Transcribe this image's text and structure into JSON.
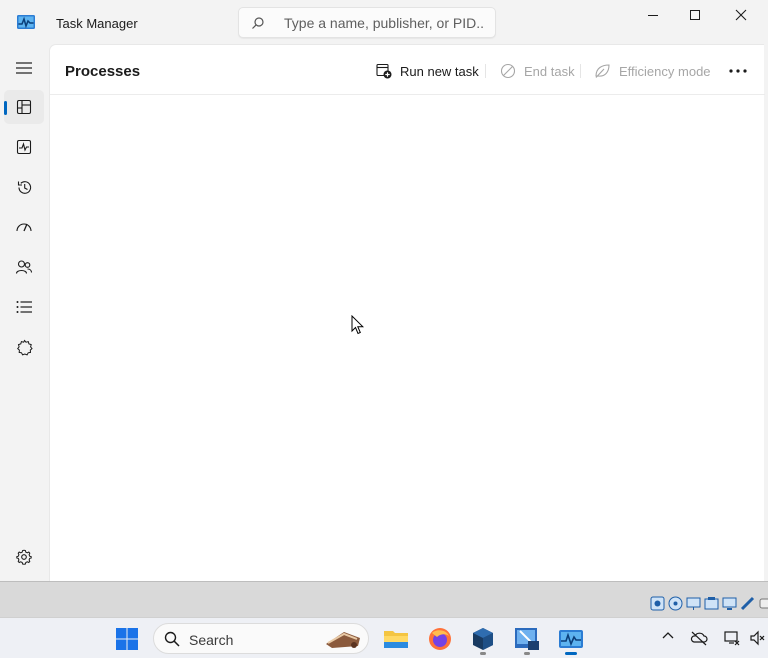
{
  "window": {
    "title": "Task Manager",
    "search_placeholder": "Type a name, publisher, or PID..."
  },
  "nav": {
    "items": [
      {
        "icon": "processes-icon",
        "selected": true
      },
      {
        "icon": "performance-icon"
      },
      {
        "icon": "app-history-icon"
      },
      {
        "icon": "startup-apps-icon"
      },
      {
        "icon": "users-icon"
      },
      {
        "icon": "details-icon"
      },
      {
        "icon": "services-icon"
      }
    ],
    "settings_icon": "gear-icon"
  },
  "page": {
    "title": "Processes",
    "run_new_task": "Run new task",
    "end_task": "End task",
    "efficiency_mode": "Efficiency mode"
  },
  "taskbar": {
    "search_label": "Search",
    "apps": [
      "file-explorer-icon",
      "firefox-icon",
      "virtualbox-icon",
      "vmware-icon",
      "task-manager-icon"
    ]
  },
  "colors": {
    "accent": "#0067c0",
    "window_bg": "#f3f3f3",
    "content_bg": "#ffffff",
    "disabled_text": "#a6a6a6"
  }
}
